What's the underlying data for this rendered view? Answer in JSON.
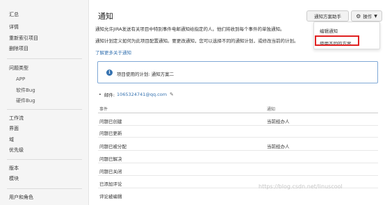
{
  "sidebar": {
    "items": [
      {
        "label": "汇总"
      },
      {
        "label": "详情"
      },
      {
        "label": "重新索引项目"
      },
      {
        "label": "删除项目"
      },
      {
        "label": "问题类型"
      },
      {
        "label": "APP"
      },
      {
        "label": "软件Bug"
      },
      {
        "label": "硬件Bug"
      },
      {
        "label": "工作流"
      },
      {
        "label": "界面"
      },
      {
        "label": "域"
      },
      {
        "label": "优先级"
      },
      {
        "label": "版本"
      },
      {
        "label": "模块"
      },
      {
        "label": "用户和角色"
      }
    ]
  },
  "main": {
    "title": "通知",
    "helper_button": "通知方案助手",
    "actions_button": "操作",
    "desc_line1": "通知允许JIRA发送有关项目中特别事件电邮通知给指定的人。他们将收到每个事件的单独通知。",
    "desc_line2": "通知计划定义如何为此项目配置通知。要更改通知，您可以选择不同的通知计划，或修改当前的计划。",
    "learn_more": "了解更多关于通知",
    "info_text": "项目使用的计划: 通知方案二",
    "email_prefix": "邮件:",
    "email": "1065324741@qq.com"
  },
  "menu": {
    "items": [
      {
        "label": "编辑通知"
      },
      {
        "label": "使用不同的方案"
      }
    ],
    "highlight_color": "#e02020"
  },
  "table": {
    "headers": [
      "事件",
      "通知"
    ],
    "rows": [
      [
        "问题已创建",
        "当前经办人"
      ],
      [
        "问题已更新",
        ""
      ],
      [
        "问题已被分配",
        "当前经办人"
      ],
      [
        "问题已解决",
        ""
      ],
      [
        "问题已关闭",
        ""
      ],
      [
        "已添加评论",
        ""
      ],
      [
        "评论被编辑",
        ""
      ]
    ]
  },
  "watermark": "https://blog.csdn.net/linuscool",
  "colors": {
    "link": "#3572b0",
    "info_border": "#7fa8d6",
    "highlight": "#e02020"
  },
  "icons": {
    "info": "info-icon",
    "gear": "gear-icon",
    "pencil": "pencil-icon",
    "chevron": "chevron-down-icon"
  }
}
